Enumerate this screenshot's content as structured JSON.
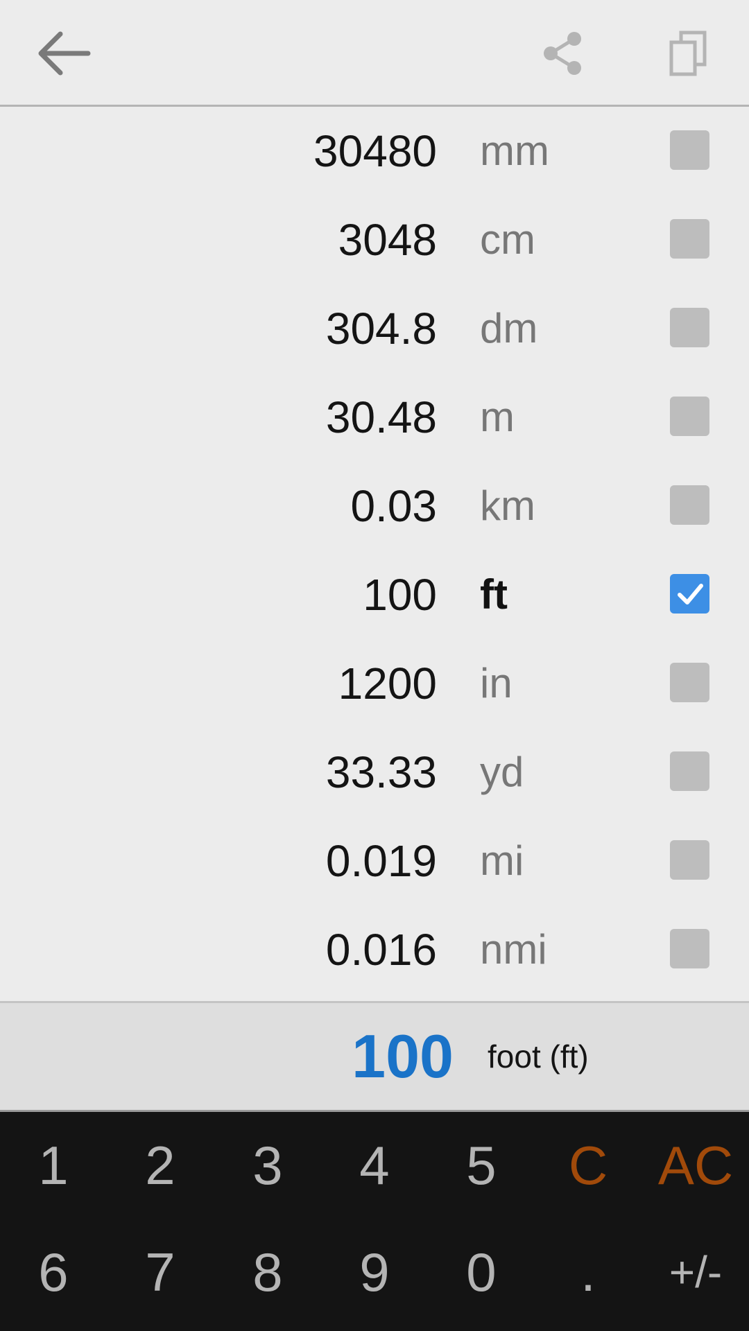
{
  "toolbar": {
    "back_icon": "arrow-left-icon",
    "share_icon": "share-icon",
    "copy_icon": "copy-icon"
  },
  "units": [
    {
      "value": "30480",
      "symbol": "mm",
      "checked": false
    },
    {
      "value": "3048",
      "symbol": "cm",
      "checked": false
    },
    {
      "value": "304.8",
      "symbol": "dm",
      "checked": false
    },
    {
      "value": "30.48",
      "symbol": "m",
      "checked": false
    },
    {
      "value": "0.03",
      "symbol": "km",
      "checked": false
    },
    {
      "value": "100",
      "symbol": "ft",
      "checked": true
    },
    {
      "value": "1200",
      "symbol": "in",
      "checked": false
    },
    {
      "value": "33.33",
      "symbol": "yd",
      "checked": false
    },
    {
      "value": "0.019",
      "symbol": "mi",
      "checked": false
    },
    {
      "value": "0.016",
      "symbol": "nmi",
      "checked": false
    }
  ],
  "current": {
    "value": "100",
    "unit_label": "foot (ft)"
  },
  "keypad": {
    "row1": [
      "1",
      "2",
      "3",
      "4",
      "5",
      "C",
      "AC"
    ],
    "row2": [
      "6",
      "7",
      "8",
      "9",
      "0",
      ".",
      "+/-"
    ]
  },
  "colors": {
    "accent_blue": "#1a73c8",
    "checkbox_checked": "#3d8fe5",
    "checkbox_unchecked": "#bdbdbd",
    "key_accent": "#a14a0a",
    "keypad_bg": "#141414"
  }
}
